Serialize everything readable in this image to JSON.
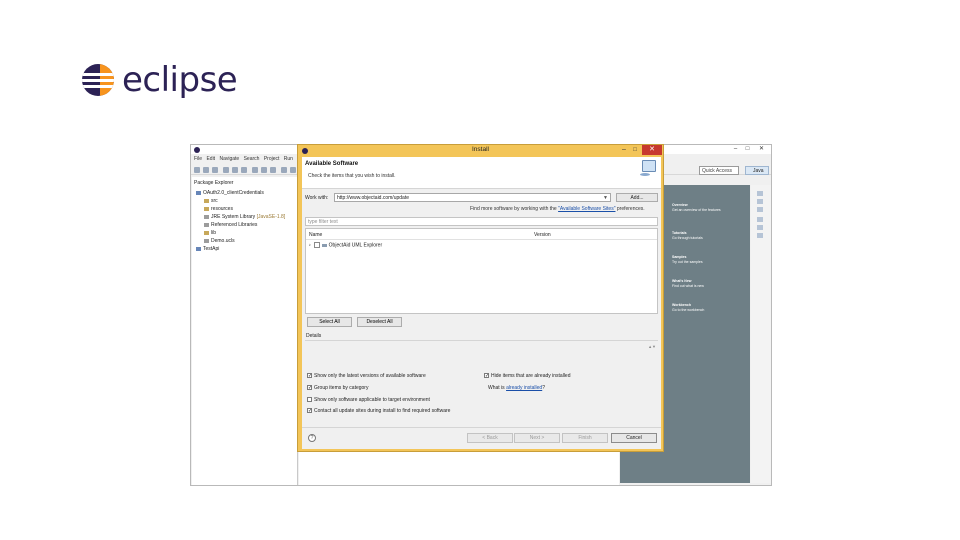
{
  "logo": {
    "text": "eclipse",
    "colors": {
      "primary": "#2c2255",
      "accent": "#f7941e"
    }
  },
  "ide": {
    "menu": [
      "File",
      "Edit",
      "Navigate",
      "Search",
      "Project",
      "Run"
    ],
    "quick_access": "Quick Access",
    "perspective": "Java",
    "package_explorer": {
      "title": "Package Explorer",
      "items": [
        {
          "label": "OAuth2.0_clientCredentials",
          "icon": "project-icon"
        },
        {
          "label": "src",
          "icon": "package-folder-icon"
        },
        {
          "label": "resources",
          "icon": "package-folder-icon"
        },
        {
          "label": "JRE System Library",
          "version": "[JavaSE-1.8]",
          "icon": "library-icon"
        },
        {
          "label": "Referenced Libraries",
          "icon": "library-icon"
        },
        {
          "label": "lib",
          "icon": "folder-icon"
        },
        {
          "label": "Demo.ucls",
          "icon": "file-icon"
        },
        {
          "label": "TestApi",
          "icon": "project-icon"
        }
      ]
    },
    "welcome": [
      {
        "title": "Overview",
        "desc": "Get an overview of the features"
      },
      {
        "title": "Tutorials",
        "desc": "Go through tutorials"
      },
      {
        "title": "Samples",
        "desc": "Try out the samples"
      },
      {
        "title": "What's New",
        "desc": "Find out what is new"
      },
      {
        "title": "Workbench",
        "desc": "Go to the workbench"
      }
    ]
  },
  "dialog": {
    "title": "Install",
    "heading": "Available Software",
    "subheading": "Check the items that you wish to install.",
    "work_with_label": "Work with:",
    "work_with_value": "http://www.objectaid.com/update",
    "add_label": "Add...",
    "more_sites_prefix": "Find more software by working with the",
    "more_sites_link": "\"Available Software Sites\"",
    "more_sites_suffix": "preferences.",
    "filter_placeholder": "type filter text",
    "columns": {
      "name": "Name",
      "version": "Version"
    },
    "rows": [
      {
        "name": "ObjectAid UML Explorer",
        "version": ""
      }
    ],
    "select_all": "Select All",
    "deselect_all": "Deselect All",
    "details_label": "Details",
    "options_left": [
      {
        "label": "Show only the latest versions of available software",
        "checked": true
      },
      {
        "label": "Group items by category",
        "checked": true
      },
      {
        "label": "Show only software applicable to target environment",
        "checked": false
      },
      {
        "label": "Contact all update sites during install to find required software",
        "checked": true
      }
    ],
    "hide_installed": {
      "label": "Hide items that are already installed",
      "checked": true
    },
    "what_is_prefix": "What is",
    "what_is_link": "already installed",
    "what_is_suffix": "?",
    "buttons": {
      "back": "< Back",
      "next": "Next >",
      "finish": "Finish",
      "cancel": "Cancel"
    },
    "colors": {
      "frame": "#f3c558",
      "close": "#c7392e",
      "link": "#1a4fa8"
    }
  }
}
